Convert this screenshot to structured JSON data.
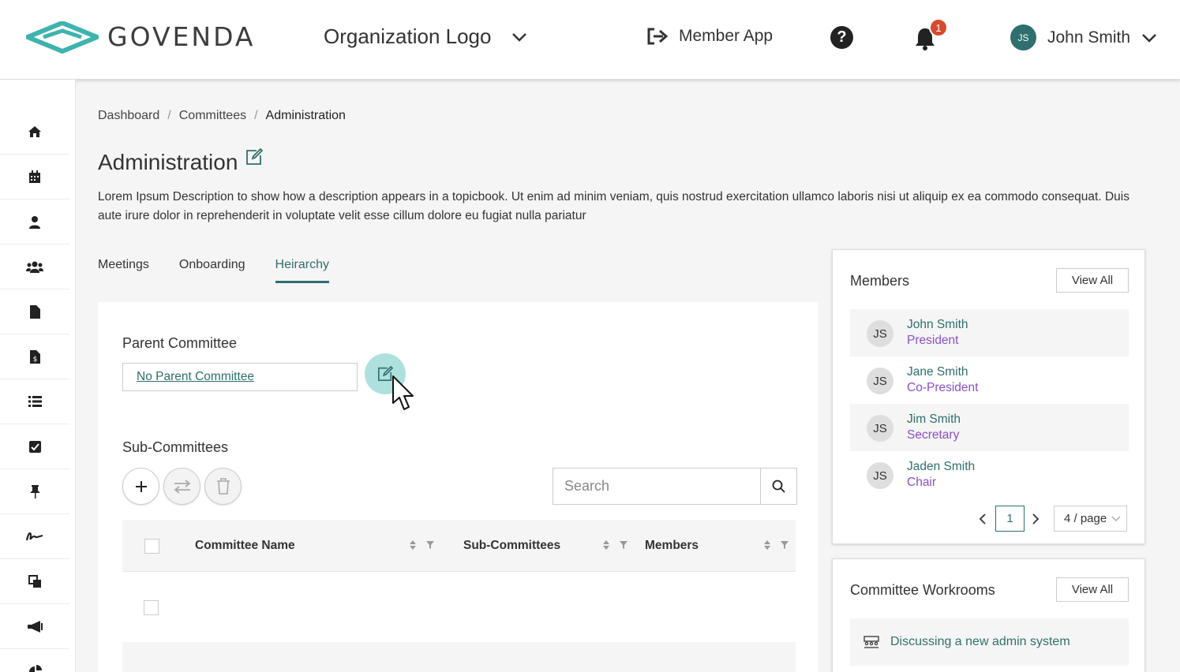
{
  "header": {
    "brand": "GOVENDA",
    "organization": "Organization Logo",
    "member_app": "Member App",
    "notification_count": "1",
    "user_initials": "JS",
    "user_name": "John Smith"
  },
  "sidebar": {
    "items": [
      {
        "icon": "home-icon"
      },
      {
        "icon": "calendar-icon"
      },
      {
        "icon": "user-icon"
      },
      {
        "icon": "users-icon"
      },
      {
        "icon": "document-icon"
      },
      {
        "icon": "invoice-icon"
      },
      {
        "icon": "list-icon"
      },
      {
        "icon": "checkbox-icon"
      },
      {
        "icon": "pin-icon"
      },
      {
        "icon": "signature-icon"
      },
      {
        "icon": "copy-icon"
      },
      {
        "icon": "megaphone-icon"
      },
      {
        "icon": "pie-chart-icon"
      }
    ]
  },
  "breadcrumb": [
    "Dashboard",
    "Committees",
    "Administration"
  ],
  "page": {
    "title": "Administration",
    "description": "Lorem Ipsum Description to show how a description appears in a topicbook. Ut enim ad minim veniam, quis nostrud exercitation ullamco laboris nisi ut aliquip ex ea commodo consequat. Duis aute irure dolor in reprehenderit in voluptate velit esse cillum dolore eu fugiat nulla pariatur"
  },
  "tabs": [
    {
      "label": "Meetings",
      "active": false
    },
    {
      "label": "Onboarding",
      "active": false
    },
    {
      "label": "Heirarchy",
      "active": true
    }
  ],
  "hierarchy": {
    "parent_label": "Parent Committee",
    "parent_value": "No Parent Committee",
    "sub_label": "Sub-Committees",
    "search_placeholder": "Search",
    "columns": [
      "Committee Name",
      "Sub-Committees",
      "Members"
    ]
  },
  "members_card": {
    "title": "Members",
    "view_all": "View All",
    "members": [
      {
        "initials": "JS",
        "name": "John Smith",
        "role": "President"
      },
      {
        "initials": "JS",
        "name": "Jane Smith",
        "role": "Co-President"
      },
      {
        "initials": "JS",
        "name": "Jim Smith",
        "role": "Secretary"
      },
      {
        "initials": "JS",
        "name": "Jaden Smith",
        "role": "Chair"
      }
    ],
    "page": "1",
    "per_page": "4 / page"
  },
  "workrooms_card": {
    "title": "Committee Workrooms",
    "view_all": "View All",
    "items": [
      "Discussing a new admin system"
    ]
  },
  "colors": {
    "accent": "#2f6f6d",
    "role": "#8a4fc8",
    "badge": "#d64a2f"
  }
}
